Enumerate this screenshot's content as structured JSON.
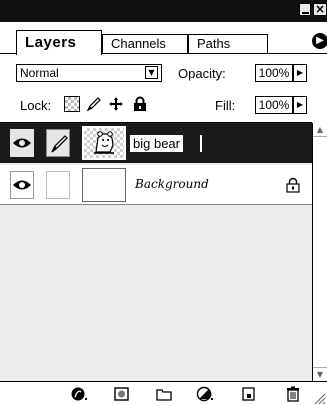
{
  "panel": {
    "tabs": [
      {
        "label": "Layers",
        "active": true
      },
      {
        "label": "Channels",
        "active": false
      },
      {
        "label": "Paths",
        "active": false
      }
    ],
    "window_buttons": {
      "close_label": "×"
    },
    "menu_icon": "triangle-menu-icon"
  },
  "controls": {
    "blend_mode": "Normal",
    "opacity_label": "Opacity:",
    "opacity_value": "100%",
    "lock_label": "Lock:",
    "fill_label": "Fill:",
    "fill_value": "100%"
  },
  "layers": [
    {
      "name": "big bear",
      "selected": true,
      "visible": true,
      "locked": false,
      "editing_name": true
    },
    {
      "name": "Background",
      "selected": false,
      "visible": true,
      "locked": true
    }
  ],
  "bottom_icons": [
    "layer-style-icon",
    "mask-icon",
    "folder-icon",
    "adjustment-layer-icon",
    "new-layer-icon",
    "trash-icon"
  ],
  "colors": {
    "selected_row": "#1a1a1a",
    "panel_bg": "#ececec",
    "title_strip": "#101010"
  }
}
